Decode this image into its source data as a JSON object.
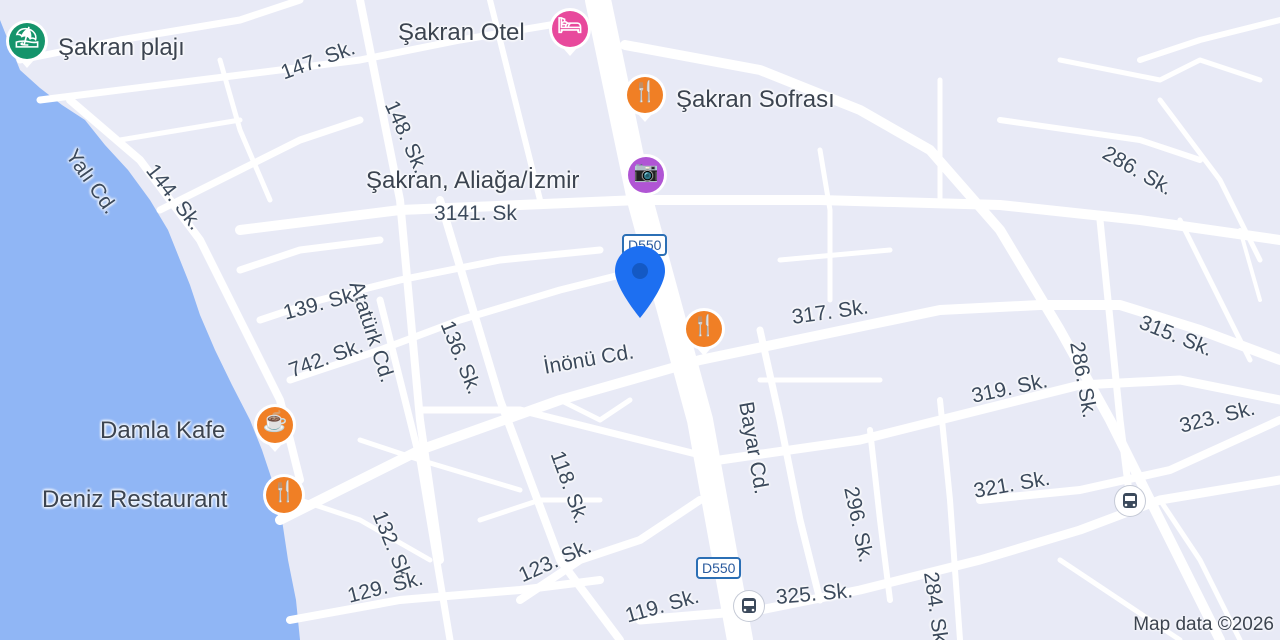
{
  "map": {
    "attribution": "Map data ©2026",
    "colors": {
      "land": "#e8eaf6",
      "water": "#90b6f5",
      "road": "#ffffff",
      "restaurant": "#f07f25",
      "hotel": "#e8499c",
      "beach": "#14946b",
      "attraction": "#b055d4",
      "location_pin": "#1d6ff1"
    },
    "pois": [
      {
        "name": "Şakran plajı",
        "icon": "beach-icon",
        "category": "beach"
      },
      {
        "name": "Şakran Otel",
        "icon": "bed-icon",
        "category": "hotel"
      },
      {
        "name": "Şakran Sofrası",
        "icon": "fork-knife-icon",
        "category": "restaurant"
      },
      {
        "name": "Şakran, Aliağa/İzmir",
        "icon": "camera-icon",
        "category": "attraction"
      },
      {
        "name": "Damla Kafe",
        "icon": "coffee-cup-icon",
        "category": "cafe"
      },
      {
        "name": "Deniz Restaurant",
        "icon": "fork-knife-icon",
        "category": "restaurant"
      },
      {
        "name": "",
        "icon": "fork-knife-icon",
        "category": "restaurant"
      }
    ],
    "streets": [
      "147. Sk.",
      "148. Sk.",
      "Yalı Cd.",
      "144. Sk.",
      "3141. Sk",
      "286. Sk.",
      "Atatürk Cd.",
      "136. Sk.",
      "139. Sk.",
      "742. Sk.",
      "317. Sk.",
      "315. Sk.",
      "İnönü Cd.",
      "Bayar Cd.",
      "286. Sk.",
      "319. Sk.",
      "323. Sk.",
      "118. Sk.",
      "296. Sk.",
      "321. Sk.",
      "132. Sk.",
      "284. Sk.",
      "123. Sk.",
      "129. Sk.",
      "119. Sk.",
      "325. Sk."
    ],
    "shields": [
      "D550",
      "D550"
    ],
    "transit": [
      {
        "icon": "bus-icon"
      },
      {
        "icon": "bus-icon"
      }
    ]
  }
}
